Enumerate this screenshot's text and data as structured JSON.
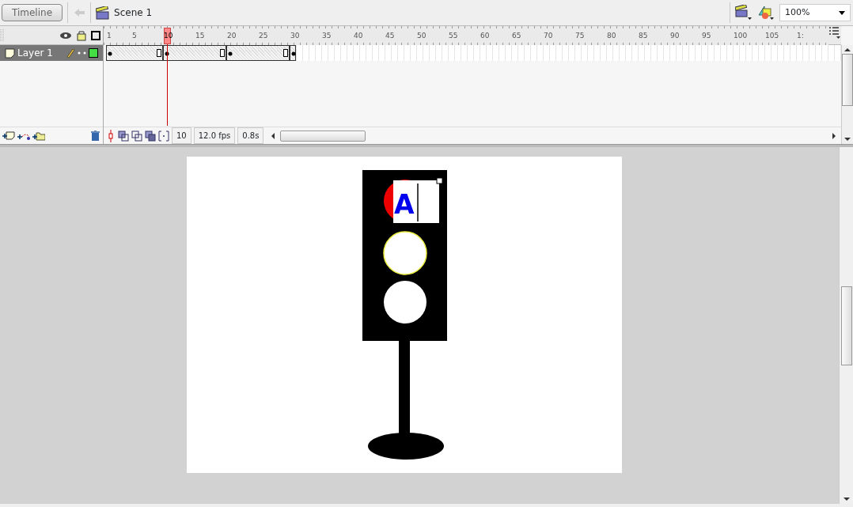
{
  "toolbar": {
    "timeline_button": "Timeline",
    "back_disabled": true,
    "scene": "Scene 1",
    "zoom": "100%"
  },
  "ruler": {
    "ticks": [
      {
        "label": "1",
        "selected": false
      },
      {
        "label": "5",
        "selected": false
      },
      {
        "label": "10",
        "selected": true
      },
      {
        "label": "15",
        "selected": false
      },
      {
        "label": "20",
        "selected": false
      },
      {
        "label": "25",
        "selected": false
      },
      {
        "label": "30",
        "selected": false
      },
      {
        "label": "35",
        "selected": false
      },
      {
        "label": "40",
        "selected": false
      },
      {
        "label": "45",
        "selected": false
      },
      {
        "label": "50",
        "selected": false
      },
      {
        "label": "55",
        "selected": false
      },
      {
        "label": "60",
        "selected": false
      },
      {
        "label": "65",
        "selected": false
      },
      {
        "label": "70",
        "selected": false
      },
      {
        "label": "75",
        "selected": false
      },
      {
        "label": "80",
        "selected": false
      },
      {
        "label": "85",
        "selected": false
      },
      {
        "label": "90",
        "selected": false
      },
      {
        "label": "95",
        "selected": false
      },
      {
        "label": "100",
        "selected": false
      },
      {
        "label": "105",
        "selected": false
      },
      {
        "label": "1:",
        "selected": false
      }
    ]
  },
  "layers": [
    {
      "name": "Layer 1",
      "selected": true,
      "color": "#44dd44",
      "frames": [
        {
          "kind": "key"
        },
        {
          "kind": "tween"
        },
        {
          "kind": "tween"
        },
        {
          "kind": "tween"
        },
        {
          "kind": "tween"
        },
        {
          "kind": "tween"
        },
        {
          "kind": "tween"
        },
        {
          "kind": "tween"
        },
        {
          "kind": "end"
        },
        {
          "kind": "key"
        },
        {
          "kind": "tween"
        },
        {
          "kind": "tween"
        },
        {
          "kind": "tween"
        },
        {
          "kind": "tween"
        },
        {
          "kind": "tween"
        },
        {
          "kind": "tween"
        },
        {
          "kind": "tween"
        },
        {
          "kind": "tween"
        },
        {
          "kind": "end"
        },
        {
          "kind": "key"
        },
        {
          "kind": "tween"
        },
        {
          "kind": "tween"
        },
        {
          "kind": "tween"
        },
        {
          "kind": "tween"
        },
        {
          "kind": "tween"
        },
        {
          "kind": "tween"
        },
        {
          "kind": "tween"
        },
        {
          "kind": "tween"
        },
        {
          "kind": "end"
        },
        {
          "kind": "key"
        }
      ]
    }
  ],
  "status": {
    "current_frame": "10",
    "fps": "12.0 fps",
    "time": "0.8s"
  },
  "stage": {
    "text_box": {
      "value": "A"
    }
  }
}
